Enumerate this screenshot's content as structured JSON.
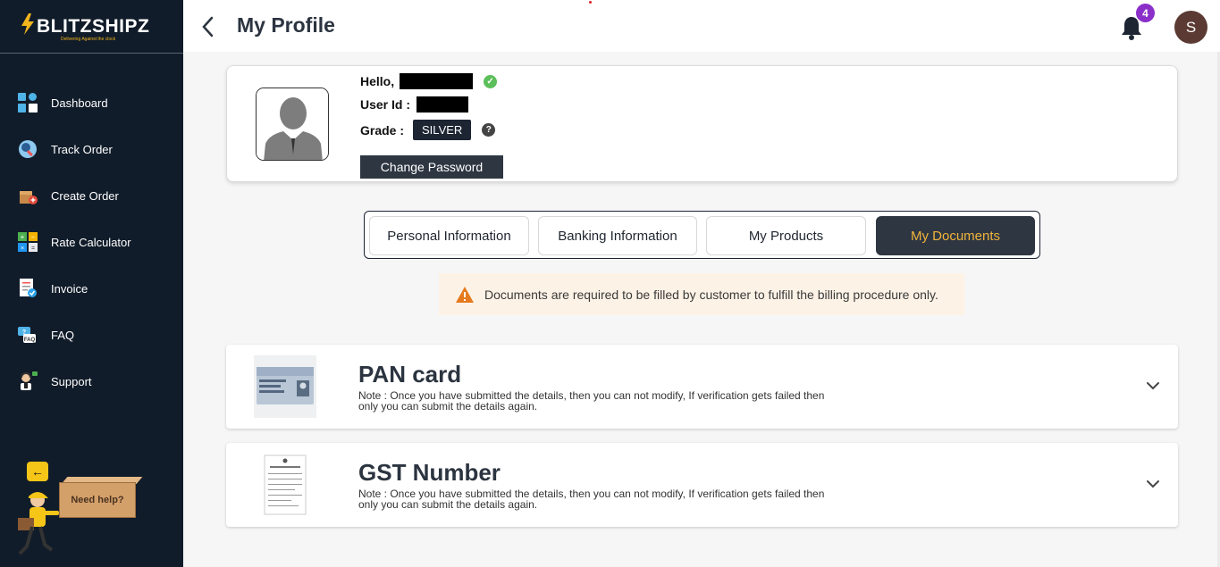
{
  "brand": {
    "name": "BLITZSHIPZ",
    "tagline": "Delivering Against the clock"
  },
  "sidebar": {
    "items": [
      {
        "label": "Dashboard",
        "icon": "dashboard-icon"
      },
      {
        "label": "Track Order",
        "icon": "track-order-icon"
      },
      {
        "label": "Create Order",
        "icon": "create-order-icon"
      },
      {
        "label": "Rate Calculator",
        "icon": "rate-calculator-icon"
      },
      {
        "label": "Invoice",
        "icon": "invoice-icon"
      },
      {
        "label": "FAQ",
        "icon": "faq-icon"
      },
      {
        "label": "Support",
        "icon": "support-icon"
      }
    ],
    "help": {
      "back_arrow": "←",
      "label": "Need help?"
    }
  },
  "header": {
    "title": "My Profile",
    "notification_count": "4",
    "avatar_initial": "S"
  },
  "profile": {
    "hello_label": "Hello,",
    "user_id_label": "User Id :",
    "grade_label": "Grade :",
    "grade_value": "SILVER",
    "help_mark": "?",
    "verified_mark": "✓",
    "change_password_label": "Change Password"
  },
  "tabs": [
    {
      "label": "Personal Information",
      "active": false
    },
    {
      "label": "Banking Information",
      "active": false
    },
    {
      "label": "My Products",
      "active": false
    },
    {
      "label": "My Documents",
      "active": true
    }
  ],
  "alert": {
    "text": "Documents are required to be filled by customer to fulfill the billing procedure only."
  },
  "documents": [
    {
      "title": "PAN card",
      "note": "Note : Once you have submitted the details, then you can not modify, If verification gets failed then only you can submit the details again."
    },
    {
      "title": "GST Number",
      "note": "Note : Once you have submitted the details, then you can not modify, If verification gets failed then only you can submit the details again."
    }
  ],
  "colors": {
    "sidebar_bg": "#111c2a",
    "accent_gold": "#f0b43b",
    "active_tab_bg": "#2e3642",
    "alert_bg": "#fdf2e6",
    "badge_purple": "#8b2fc9"
  }
}
